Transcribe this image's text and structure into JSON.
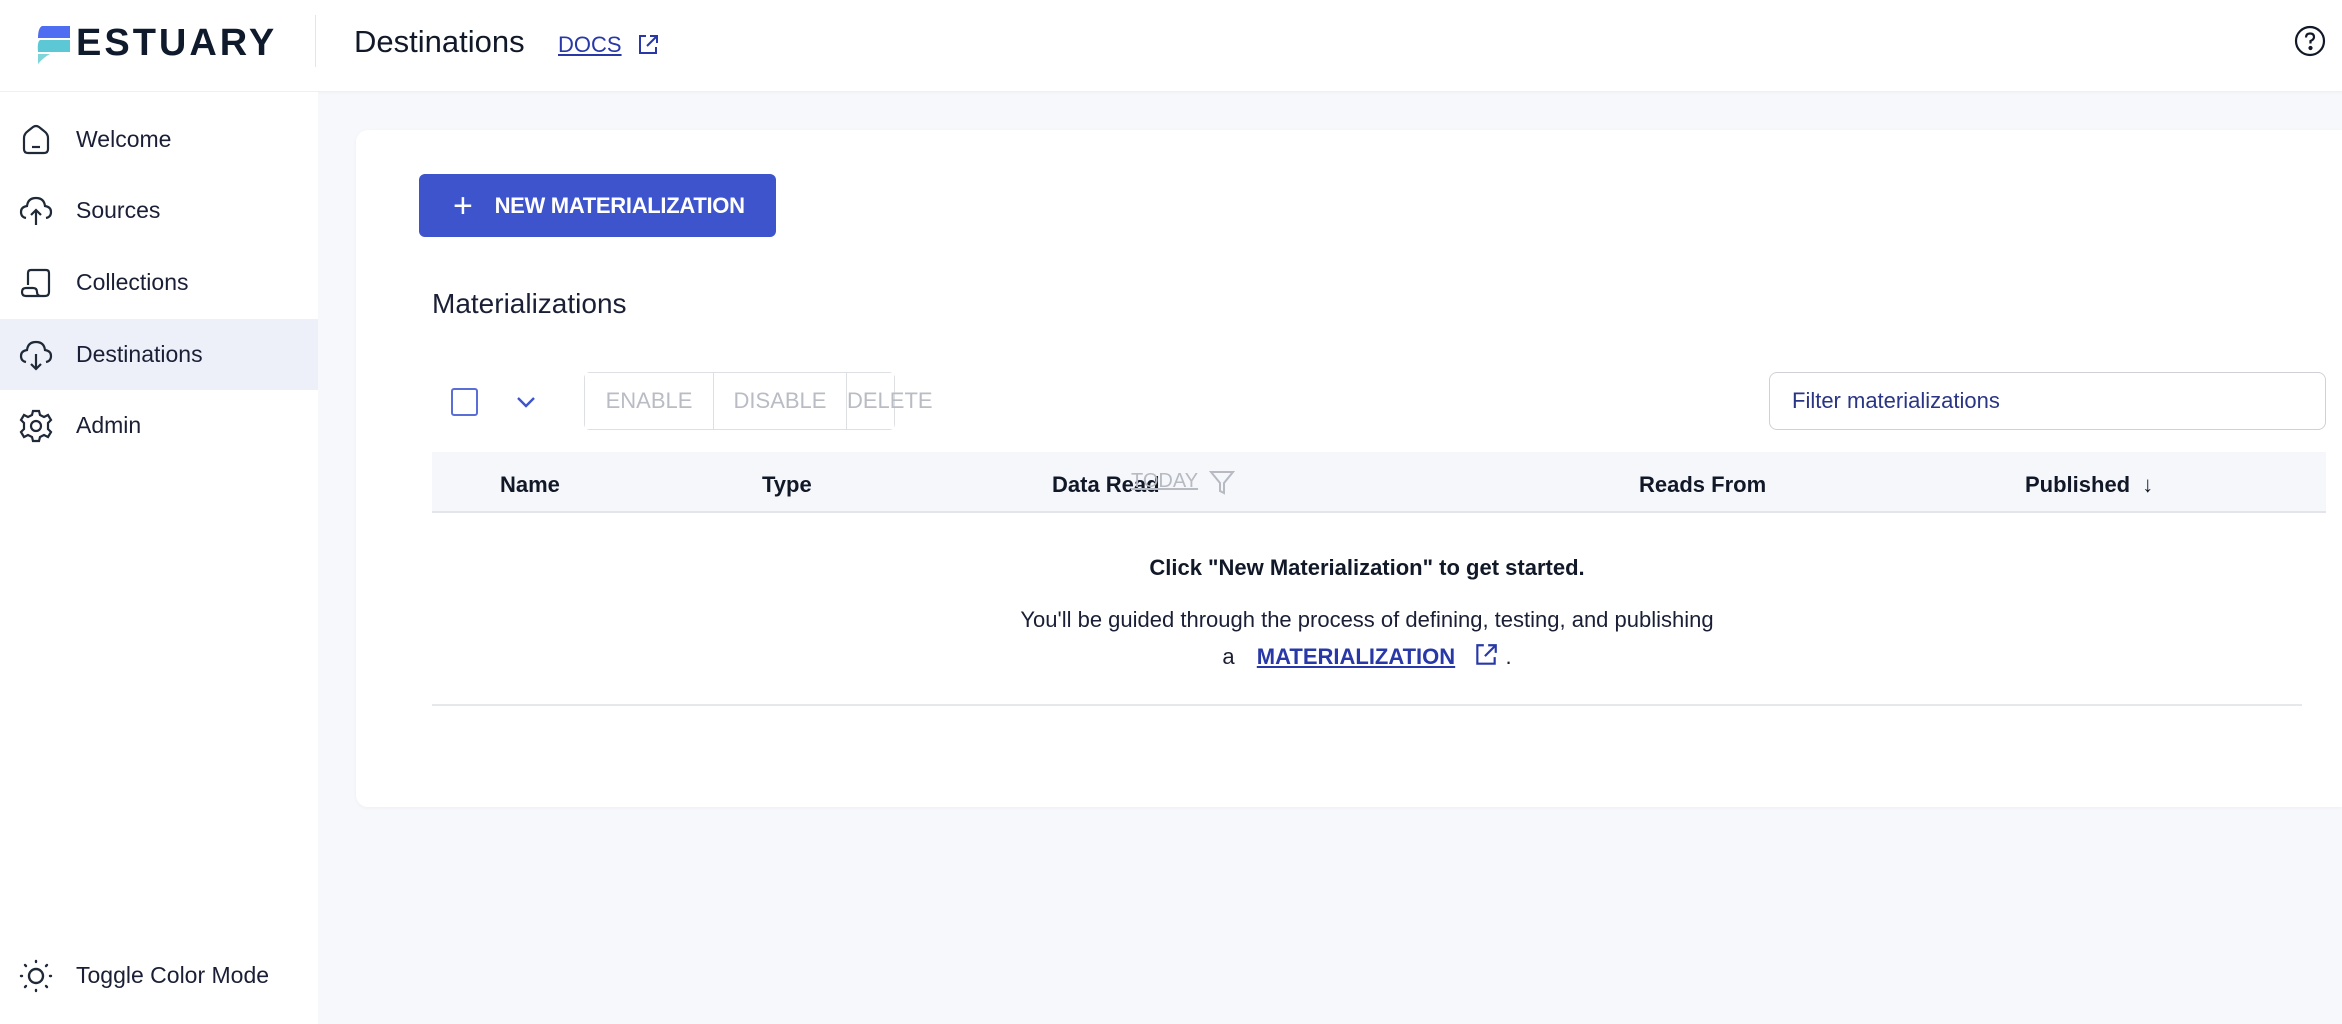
{
  "header": {
    "logo_text": "ESTUARY",
    "page_title": "Destinations",
    "docs_label": "DOCS",
    "help_icon": "help-circle-icon"
  },
  "sidebar": {
    "items": [
      {
        "label": "Welcome",
        "icon": "home-icon",
        "active": false
      },
      {
        "label": "Sources",
        "icon": "cloud-upload-icon",
        "active": false
      },
      {
        "label": "Collections",
        "icon": "collections-icon",
        "active": false
      },
      {
        "label": "Destinations",
        "icon": "cloud-download-icon",
        "active": true
      },
      {
        "label": "Admin",
        "icon": "gear-icon",
        "active": false
      }
    ],
    "toggle_label": "Toggle Color Mode"
  },
  "main": {
    "new_button_label": "NEW MATERIALIZATION",
    "section_title": "Materializations",
    "bulk_actions": [
      "ENABLE",
      "DISABLE",
      "DELETE"
    ],
    "filter_placeholder": "Filter materializations",
    "columns": {
      "name": "Name",
      "type": "Type",
      "data_read": "Data Read",
      "data_read_period": "TODAY",
      "reads_from": "Reads From",
      "published": "Published",
      "published_sort": "↓"
    },
    "empty_state": {
      "title": "Click \"New Materialization\" to get started.",
      "body": "You'll be guided through the process of defining, testing, and publishing",
      "body_prefix": "a",
      "link_label": "MATERIALIZATION",
      "suffix": "."
    }
  },
  "colors": {
    "primary": "#3d54cc",
    "link": "#2838a8",
    "active_nav_bg": "#edf0f8",
    "page_bg": "#f7f8fb"
  }
}
